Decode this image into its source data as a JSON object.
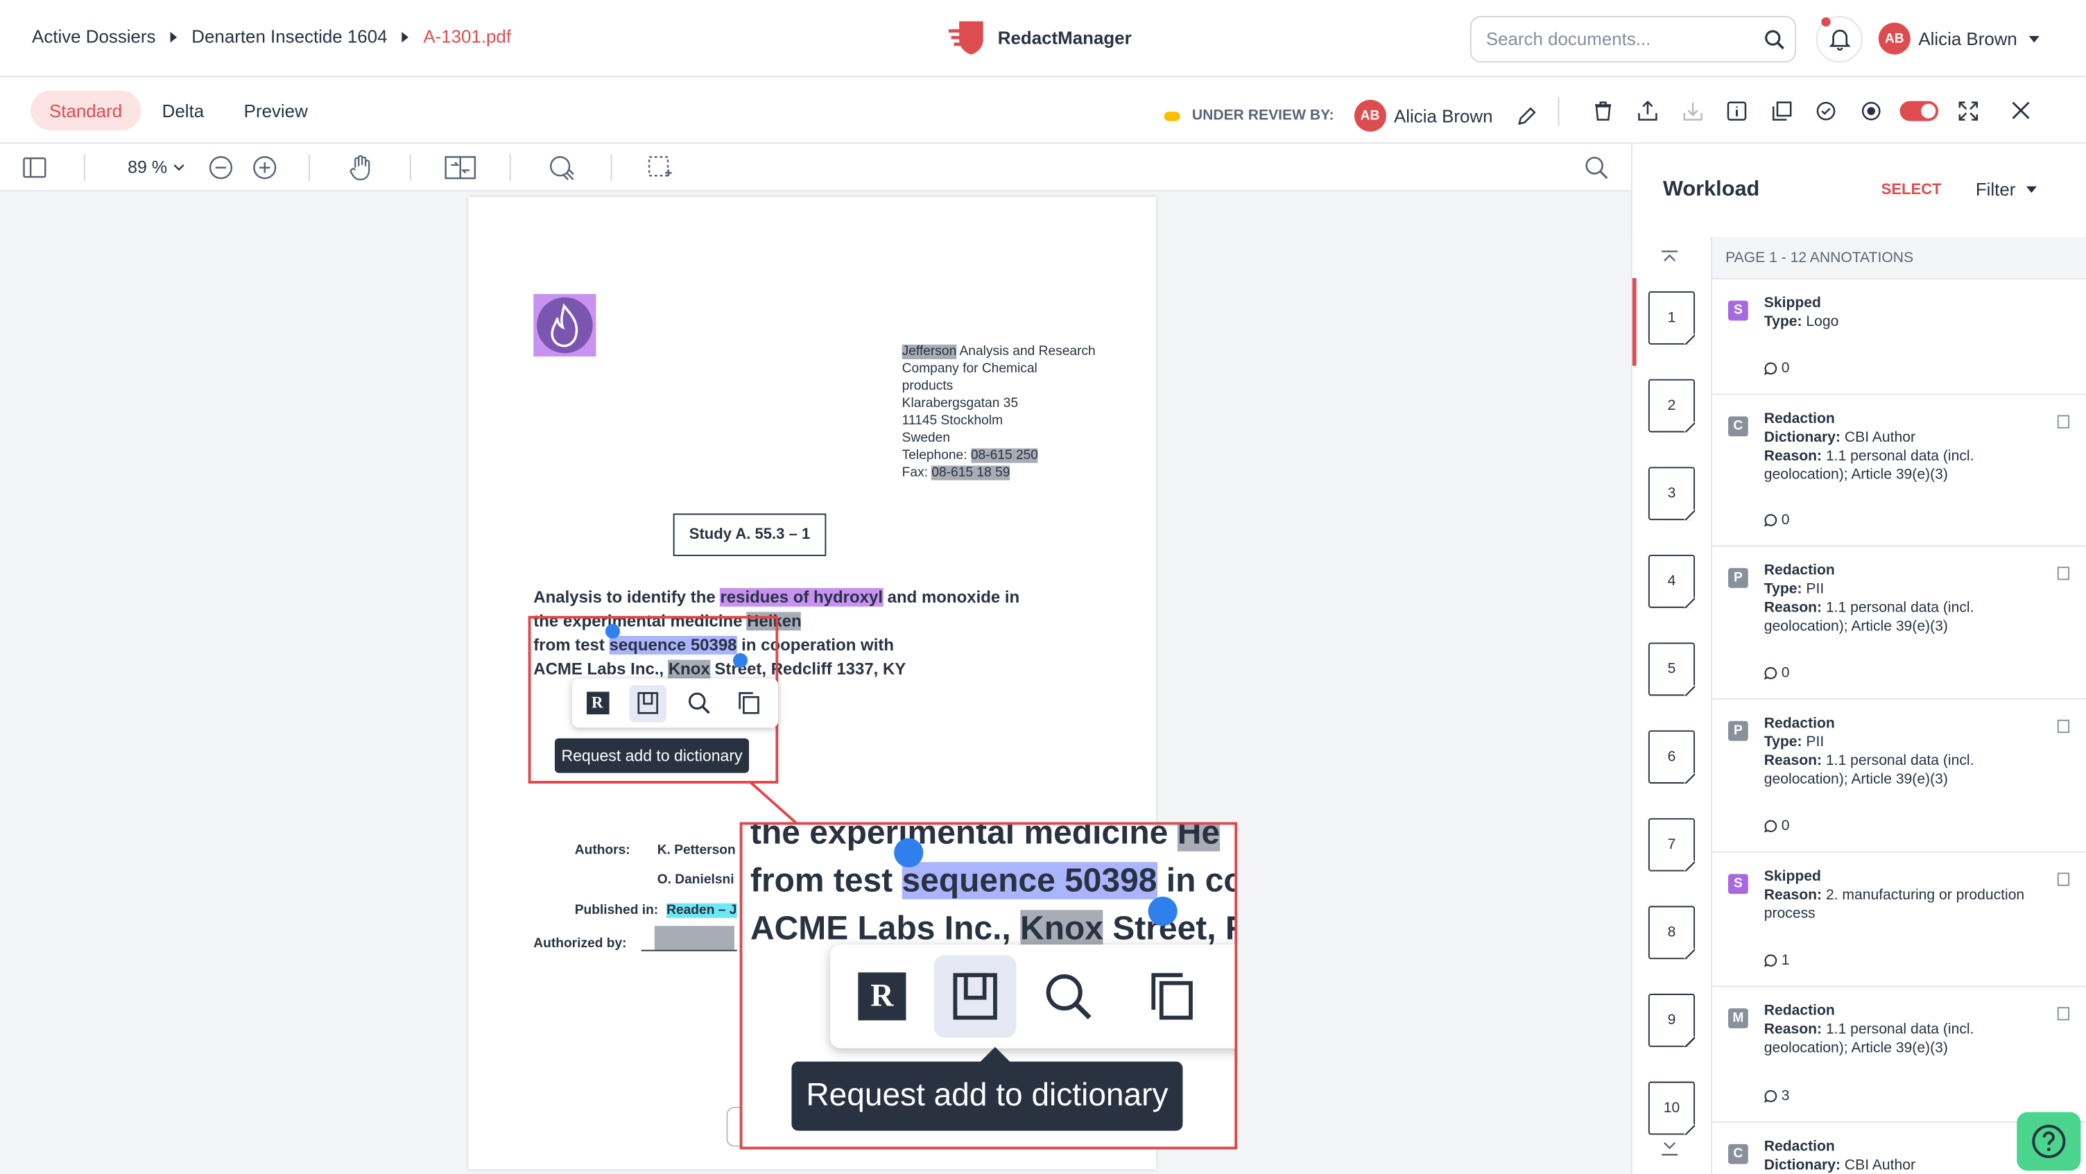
{
  "breadcrumb": {
    "items": [
      "Active Dossiers",
      "Denarten Insectide 1604",
      "A-1301.pdf"
    ]
  },
  "app": {
    "name": "RedactManager"
  },
  "search": {
    "placeholder": "Search documents..."
  },
  "user": {
    "initials": "AB",
    "name": "Alicia Brown"
  },
  "tabs": [
    "Standard",
    "Delta",
    "Preview"
  ],
  "review": {
    "label": "UNDER REVIEW BY:",
    "initials": "AB",
    "name": "Alicia Brown"
  },
  "viewer": {
    "zoom": "89 %"
  },
  "document": {
    "address_lines": [
      {
        "pre": "",
        "hl": "Jefferson",
        "post": " Analysis and Research"
      },
      {
        "pre": "Company for Chemical",
        "hl": "",
        "post": ""
      },
      {
        "pre": "products",
        "hl": "",
        "post": ""
      },
      {
        "pre": "Klarabergsgatan 35",
        "hl": "",
        "post": ""
      },
      {
        "pre": "11145 Stockholm",
        "hl": "",
        "post": ""
      },
      {
        "pre": "Sweden",
        "hl": "",
        "post": ""
      },
      {
        "pre": "Telephone: ",
        "hl": "08-615 250",
        "post": ""
      },
      {
        "pre": "Fax: ",
        "hl": "08-615 18 59",
        "post": ""
      }
    ],
    "study_title": "Study A. 55.3 – 1",
    "body": {
      "l1_pre": "Analysis to identify the ",
      "l1_hl": "residues of hydroxyl",
      "l1_post": " and monoxide in",
      "l2_pre": "the experimental medicine ",
      "l2_hl": "Helken",
      "l3_pre": "from test ",
      "l3_hl": "sequence 50398",
      "l3_post": " in cooperation with",
      "l4_pre": "ACME Labs Inc., ",
      "l4_hl": "Knox",
      "l4_post": " Street, Redcliff 1337, KY"
    },
    "authors_label": "Authors:",
    "author1": "K. Petterson",
    "author2": "O. Danielsni",
    "published_label": "Published in:",
    "published_value": "Readen – J",
    "authorized_label": "Authorized by:"
  },
  "popup": {
    "tooltip": "Request add to dictionary",
    "actions": [
      "redact-r",
      "add-to-dictionary",
      "search",
      "copy"
    ]
  },
  "zoom_callout": {
    "line1_pre": "the experimental medicine ",
    "line1_hl": "He",
    "line2_pre": "from test ",
    "line2_hl": "sequence 50398",
    "line2_post": " in co",
    "line3_pre": "ACME Labs Inc., ",
    "line3_hl": "Knox",
    "line3_post": " Street, R",
    "tooltip": "Request add to dictionary"
  },
  "workload": {
    "title": "Workload",
    "select": "SELECT",
    "filter": "Filter",
    "page_header": "PAGE 1 - 12 ANNOTATIONS",
    "pages": [
      "1",
      "2",
      "3",
      "4",
      "5",
      "6",
      "7",
      "8",
      "9",
      "10"
    ],
    "annotations": [
      {
        "badge": "S",
        "color": "#a769e0",
        "title": "Skipped",
        "k1": "Type:",
        "v1": "Logo",
        "k2": "",
        "v2": "",
        "comments": "0",
        "icon": ""
      },
      {
        "badge": "C",
        "color": "#8a919c",
        "title": "Redaction",
        "k1": "Dictionary:",
        "v1": "CBI Author",
        "k2": "Reason:",
        "v2": "1.1 personal data (incl. geolocation); Article 39(e)(3)",
        "comments": "0",
        "icon": "book-icon"
      },
      {
        "badge": "P",
        "color": "#8a919c",
        "title": "Redaction",
        "k1": "Type:",
        "v1": "PII",
        "k2": "Reason:",
        "v2": "1.1 personal data (incl. geolocation); Article 39(e)(3)",
        "comments": "0",
        "icon": "code-icon"
      },
      {
        "badge": "P",
        "color": "#8a919c",
        "title": "Redaction",
        "k1": "Type:",
        "v1": "PII",
        "k2": "Reason:",
        "v2": "1.1 personal data (incl. geolocation); Article 39(e)(3)",
        "comments": "0",
        "icon": "code-icon"
      },
      {
        "badge": "S",
        "color": "#a769e0",
        "title": "Skipped",
        "k1": "Reason:",
        "v1": "2. manufacturing or production process",
        "k2": "",
        "v2": "",
        "comments": "1",
        "icon": "hand-icon"
      },
      {
        "badge": "M",
        "color": "#8a919c",
        "title": "Redaction",
        "k1": "Reason:",
        "v1": "1.1 personal data (incl. geolocation); Article 39(e)(3)",
        "k2": "",
        "v2": "",
        "comments": "3",
        "icon": "hand-icon"
      },
      {
        "badge": "C",
        "color": "#8a919c",
        "title": "Redaction",
        "k1": "Dictionary:",
        "v1": "CBI Author",
        "k2": "",
        "v2": "",
        "comments": "",
        "icon": ""
      }
    ]
  },
  "colors": {
    "accent": "#dd4d50",
    "toggle": "#dd4d50",
    "help": "#4ad48c",
    "selection_handle": "#2f80ed"
  }
}
